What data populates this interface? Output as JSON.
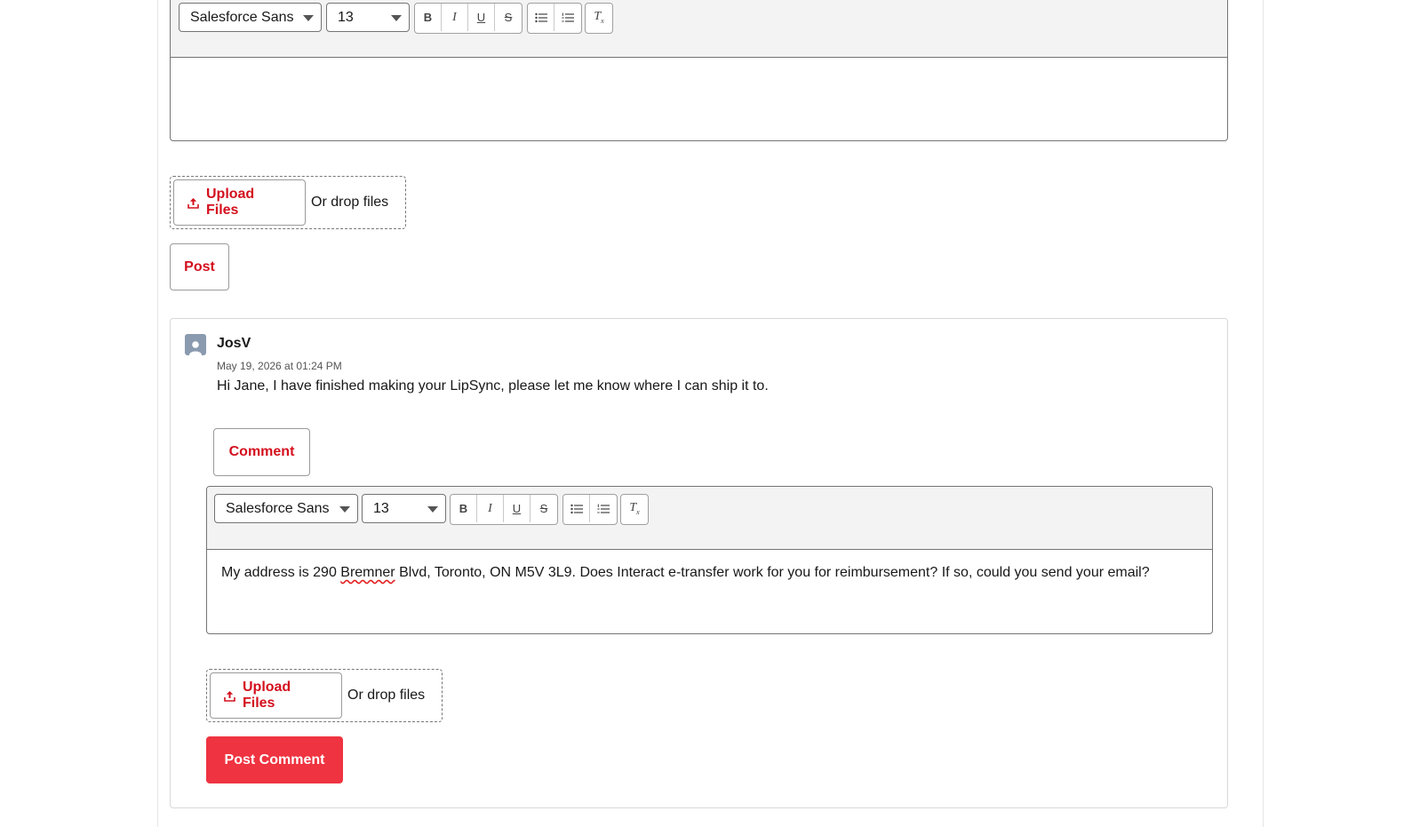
{
  "top_editor": {
    "font_family": "Salesforce Sans",
    "font_size": "13",
    "body_text": ""
  },
  "top_upload": {
    "button_label": "Upload Files",
    "drop_label": "Or drop files"
  },
  "post_button": "Post",
  "comment": {
    "author": "JosV",
    "timestamp": "May 19, 2026 at 01:24 PM",
    "body": "Hi Jane, I have finished making your LipSync, please let me know where I can ship it to.",
    "comment_button": "Comment"
  },
  "reply_editor": {
    "font_family": "Salesforce Sans",
    "font_size": "13",
    "body_before": "My address is 290 ",
    "body_misspelled": "Bremner",
    "body_after": " Blvd, Toronto, ON M5V 3L9. Does Interact e-transfer work for you for reimbursement? If so, could you send your email?"
  },
  "reply_upload": {
    "button_label": "Upload Files",
    "drop_label": "Or drop files"
  },
  "post_comment_button": "Post Comment",
  "toolbar_icons": [
    "bold-icon",
    "italic-icon",
    "underline-icon",
    "strikethrough-icon",
    "bulleted-list-icon",
    "numbered-list-icon",
    "clear-formatting-icon"
  ],
  "colors": {
    "accent": "#d4101e",
    "primary_button": "#ef3340",
    "toolbar_bg": "#f3f3f3",
    "avatar": "#8a9bb0"
  }
}
